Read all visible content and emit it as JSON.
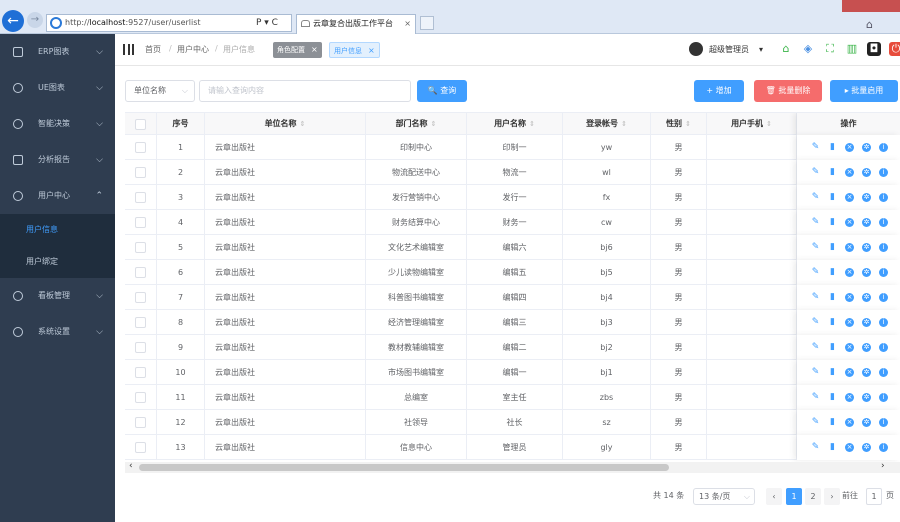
{
  "browser": {
    "url_prefix": "http://",
    "url_host": "localhost",
    "url_rest": ":9527/user/userlist",
    "addr_tools": "P ▾ C",
    "tab_title": "云章复合出版工作平台",
    "tab_close": "×"
  },
  "sidebar": {
    "items": [
      {
        "label": "ERP图表",
        "arrow": "⌵"
      },
      {
        "label": "UE图表",
        "arrow": "⌵"
      },
      {
        "label": "智能决策",
        "arrow": "⌵"
      },
      {
        "label": "分析报告",
        "arrow": "⌵"
      },
      {
        "label": "用户中心",
        "arrow": "⌃"
      },
      {
        "label": "看板管理",
        "arrow": "⌵"
      },
      {
        "label": "系统设置",
        "arrow": "⌵"
      }
    ],
    "subitems": [
      {
        "label": "用户信息",
        "active": true
      },
      {
        "label": "用户绑定",
        "active": false
      }
    ]
  },
  "header": {
    "breadcrumbs": [
      "首页",
      "用户中心",
      "用户信息"
    ],
    "sep": "/",
    "tags": [
      {
        "label": "角色配置",
        "close": "×"
      },
      {
        "label": "用户信息",
        "close": "×"
      }
    ],
    "user": "超级管理员",
    "user_caret": "▾"
  },
  "toolbar": {
    "select_value": "单位名称",
    "select_caret": "⌵",
    "search_placeholder": "请输入查询内容",
    "search_btn": "🔍 查询",
    "add_btn": "+ 增加",
    "batch_delete_btn": "🗑 批量删除",
    "batch_enable_btn": "▸ 批量启用"
  },
  "table": {
    "columns": [
      "序号",
      "单位名称",
      "部门名称",
      "用户名称",
      "登录帐号",
      "性别",
      "用户手机",
      "操作"
    ],
    "sort_icon": "⇕",
    "rows": [
      {
        "no": "1",
        "unit": "云章出版社",
        "dept": "印制中心",
        "name": "印制一",
        "account": "yw",
        "gender": "男",
        "phone": ""
      },
      {
        "no": "2",
        "unit": "云章出版社",
        "dept": "物流配送中心",
        "name": "物流一",
        "account": "wl",
        "gender": "男",
        "phone": ""
      },
      {
        "no": "3",
        "unit": "云章出版社",
        "dept": "发行营销中心",
        "name": "发行一",
        "account": "fx",
        "gender": "男",
        "phone": ""
      },
      {
        "no": "4",
        "unit": "云章出版社",
        "dept": "财务结算中心",
        "name": "财务一",
        "account": "cw",
        "gender": "男",
        "phone": ""
      },
      {
        "no": "5",
        "unit": "云章出版社",
        "dept": "文化艺术编辑室",
        "name": "编辑六",
        "account": "bj6",
        "gender": "男",
        "phone": ""
      },
      {
        "no": "6",
        "unit": "云章出版社",
        "dept": "少儿读物编辑室",
        "name": "编辑五",
        "account": "bj5",
        "gender": "男",
        "phone": ""
      },
      {
        "no": "7",
        "unit": "云章出版社",
        "dept": "科普图书编辑室",
        "name": "编辑四",
        "account": "bj4",
        "gender": "男",
        "phone": ""
      },
      {
        "no": "8",
        "unit": "云章出版社",
        "dept": "经济管理编辑室",
        "name": "编辑三",
        "account": "bj3",
        "gender": "男",
        "phone": ""
      },
      {
        "no": "9",
        "unit": "云章出版社",
        "dept": "教材教辅编辑室",
        "name": "编辑二",
        "account": "bj2",
        "gender": "男",
        "phone": ""
      },
      {
        "no": "10",
        "unit": "云章出版社",
        "dept": "市场图书编辑室",
        "name": "编辑一",
        "account": "bj1",
        "gender": "男",
        "phone": ""
      },
      {
        "no": "11",
        "unit": "云章出版社",
        "dept": "总编室",
        "name": "室主任",
        "account": "zbs",
        "gender": "男",
        "phone": ""
      },
      {
        "no": "12",
        "unit": "云章出版社",
        "dept": "社领导",
        "name": "社长",
        "account": "sz",
        "gender": "男",
        "phone": ""
      },
      {
        "no": "13",
        "unit": "云章出版社",
        "dept": "信息中心",
        "name": "管理员",
        "account": "gly",
        "gender": "男",
        "phone": ""
      }
    ],
    "ops_icons": [
      "edit-icon",
      "delete-icon",
      "disable-icon",
      "settings-icon",
      "info-icon"
    ]
  },
  "scroll": {
    "left": "‹",
    "right": "›"
  },
  "pagination": {
    "total": "共 14 条",
    "page_size": "13 条/页",
    "size_caret": "⌵",
    "prev": "‹",
    "pages": [
      "1",
      "2"
    ],
    "next": "›",
    "goto_label": "前往",
    "goto_value": "1",
    "page_unit": "页"
  },
  "colors": {
    "primary": "#409eff",
    "danger": "#f56c6c",
    "sidebar": "#2f3d50"
  }
}
